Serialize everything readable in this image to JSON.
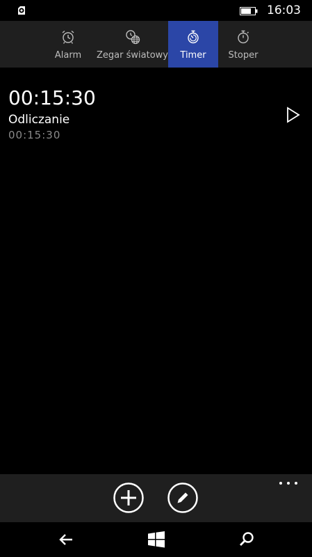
{
  "status_bar": {
    "time": "16:03",
    "left_icon": "notification-app-icon",
    "battery_icon": "battery-icon"
  },
  "tabs": [
    {
      "label": "Alarm",
      "icon": "alarm-clock-icon",
      "active": false
    },
    {
      "label": "Zegar światowy",
      "icon": "world-clock-icon",
      "active": false
    },
    {
      "label": "Timer",
      "icon": "timer-icon",
      "active": true
    },
    {
      "label": "Stoper",
      "icon": "stopwatch-icon",
      "active": false
    }
  ],
  "timers": [
    {
      "time": "00:15:30",
      "name": "Odliczanie",
      "duration": "00:15:30",
      "action_icon": "play-icon"
    }
  ],
  "app_bar": {
    "buttons": [
      {
        "icon": "add-icon"
      },
      {
        "icon": "edit-icon"
      }
    ],
    "more_icon": "more-icon"
  },
  "nav_bar": {
    "buttons": [
      {
        "icon": "back-icon"
      },
      {
        "icon": "windows-start-icon"
      },
      {
        "icon": "search-icon"
      }
    ]
  },
  "colors": {
    "accent": "#2b46a7",
    "bar_background": "#1f1f1f",
    "background": "#000000",
    "secondary_text": "#8a8a8a"
  }
}
